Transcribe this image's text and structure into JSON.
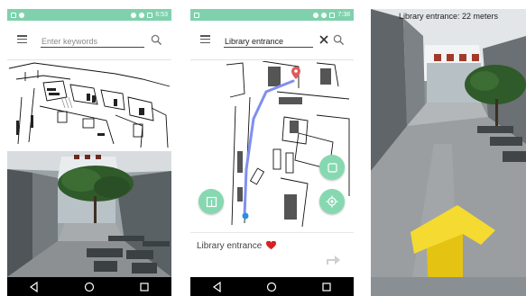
{
  "screen1": {
    "status_time": "6:53",
    "search": {
      "placeholder": "Enter keywords",
      "value": ""
    }
  },
  "screen2": {
    "status_time": "7:38",
    "search": {
      "value": "Library entrance"
    },
    "place_name": "Library entrance"
  },
  "screen3": {
    "ar_label": "Library entrance: 22 meters"
  },
  "colors": {
    "statusbar": "#7fd1ad",
    "fab": "#86d8b1",
    "route": "#7f8ff0",
    "marker": "#e05a5a",
    "heart": "#d62222",
    "arrow": "#f2d21f"
  },
  "icons": {
    "menu": "menu-icon",
    "search": "search-icon",
    "clear": "close-icon",
    "heart": "heart-icon",
    "directions": "directions-arrow-icon",
    "back": "nav-back-icon",
    "home": "nav-home-icon",
    "recents": "nav-recents-icon"
  }
}
